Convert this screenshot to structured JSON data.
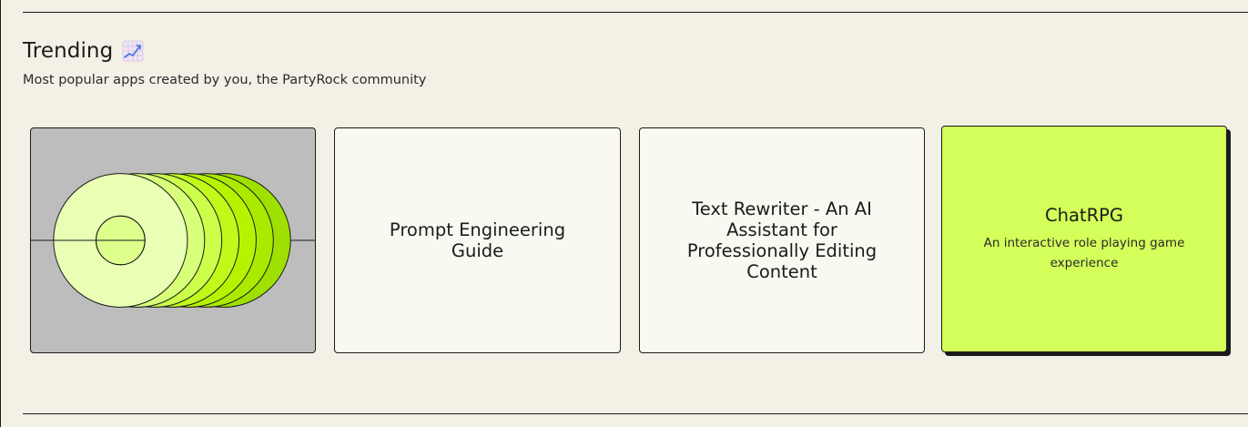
{
  "section": {
    "title": "Trending",
    "icon": "chart-increasing-icon",
    "subtitle": "Most popular apps created by you, the PartyRock community"
  },
  "cards": [
    {
      "title": "",
      "art": "concentric-rings-illustration"
    },
    {
      "title": "Prompt Engineering Guide"
    },
    {
      "title": "Text Rewriter - An AI Assistant for Professionally Editing Content"
    },
    {
      "title": "ChatRPG",
      "description": "An interactive role playing game experience"
    }
  ],
  "colors": {
    "background": "#f3f1e6",
    "card_background": "#f9f8f1",
    "accent_card": "#d4ff5a",
    "art_background": "#bdbdbd",
    "ink": "#1b1b1b"
  }
}
